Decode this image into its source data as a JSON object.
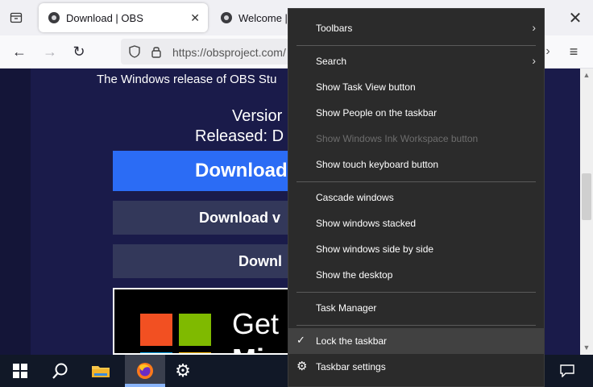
{
  "browser": {
    "tabs": [
      {
        "title": "Download | OBS",
        "close": "✕"
      },
      {
        "title": "Welcome | O"
      }
    ],
    "window_close": "✕",
    "url": "https://obsproject.com/",
    "nav": {
      "back": "←",
      "forward": "→",
      "reload": "↻",
      "menu": "≡",
      "overflow": "›"
    }
  },
  "page": {
    "intro": "The Windows release of OBS Stu",
    "version": "Versior",
    "released": "Released: D",
    "download_button": "Download",
    "download_button_2": "Download v",
    "download_button_3": "Downl",
    "ms_store": {
      "line1": "Get",
      "line2": "Mi"
    }
  },
  "context_menu": {
    "items": [
      {
        "label": "Toolbars",
        "has_submenu": true
      },
      {
        "label": "Search",
        "has_submenu": true
      },
      {
        "label": "Show Task View button"
      },
      {
        "label": "Show People on the taskbar"
      },
      {
        "label": "Show Windows Ink Workspace button",
        "disabled": true
      },
      {
        "label": "Show touch keyboard button"
      },
      {
        "label": "Cascade windows"
      },
      {
        "label": "Show windows stacked"
      },
      {
        "label": "Show windows side by side"
      },
      {
        "label": "Show the desktop"
      },
      {
        "label": "Task Manager"
      },
      {
        "label": "Lock the taskbar",
        "checked": true
      },
      {
        "label": "Taskbar settings"
      }
    ],
    "submenu_glyph": "›",
    "check_glyph": "✓",
    "settings_glyph": "⚙"
  },
  "taskbar": {
    "icons": [
      "windows-start-icon",
      "search-icon",
      "file-explorer-icon",
      "firefox-icon",
      "settings-icon"
    ],
    "search_glyph": "⚲",
    "settings_glyph": "⚙",
    "notification_glyph": "▭"
  },
  "colors": {
    "menu_bg": "#2b2b2b",
    "taskbar_bg": "#111827",
    "download_blue": "#2b6cf5",
    "page_bg": "#1a1b4a"
  }
}
